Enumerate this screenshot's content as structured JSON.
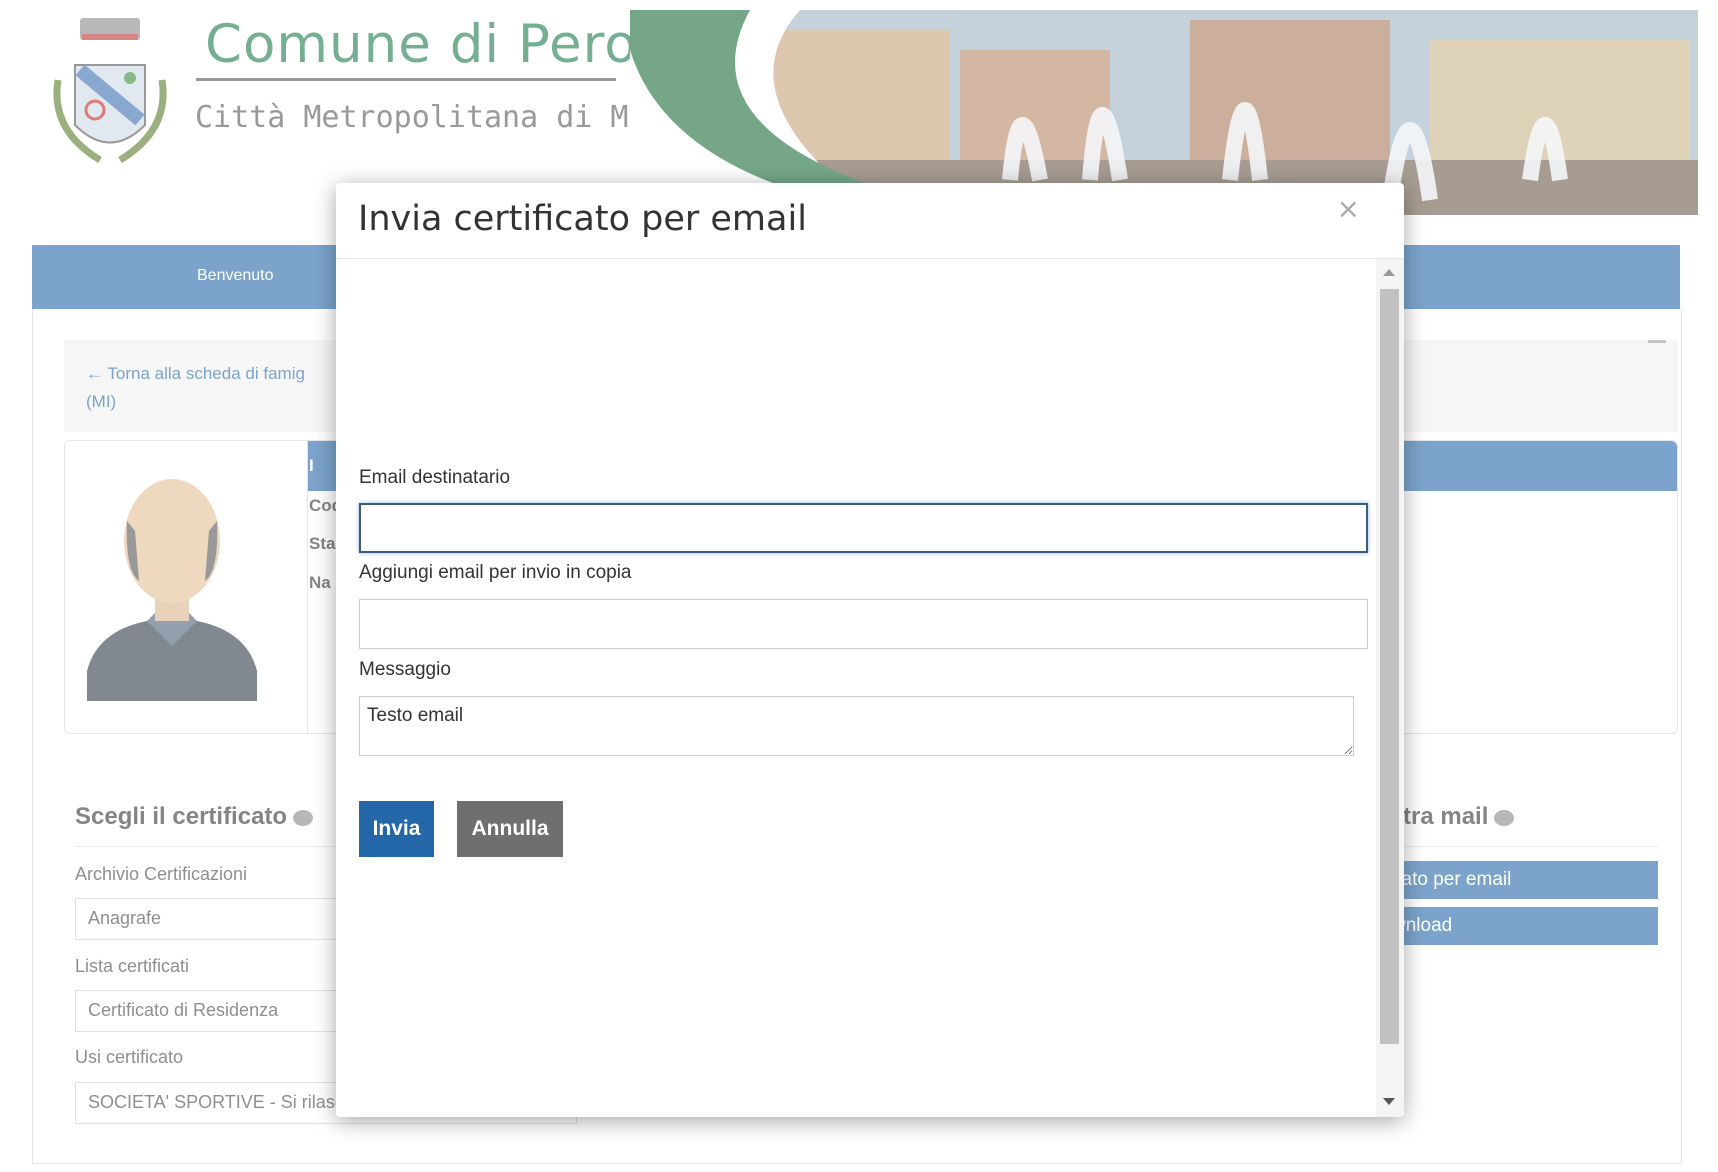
{
  "site": {
    "title": "Comune di Pero",
    "subtitle": "Città Metropolitana di Milano"
  },
  "nav": {
    "items": [
      "Benvenuto"
    ]
  },
  "background": {
    "back_link": "Torna alla scheda di famig",
    "back_link_suffix": "(MI)",
    "info_labels": [
      "Cod",
      "Sta",
      "Na"
    ],
    "section_left_title": "Scegli il certificato",
    "section_right_title": "tra mail",
    "fields": [
      {
        "label": "Archivio Certificazioni",
        "value": "Anagrafe"
      },
      {
        "label": "Lista certificati",
        "value": "Certificato di Residenza"
      },
      {
        "label": "Usi certificato",
        "value": "SOCIETA' SPORTIVE - Si rilasc"
      }
    ],
    "right_buttons": [
      "cato per email",
      "wnload"
    ]
  },
  "modal": {
    "title": "Invia certificato per email",
    "close_symbol": "×",
    "email_label": "Email destinatario",
    "email_value": "",
    "cc_label": "Aggiungi email per invio in copia",
    "cc_value": "",
    "message_label": "Messaggio",
    "message_value": "Testo email",
    "submit_label": "Invia",
    "cancel_label": "Annulla"
  },
  "colors": {
    "primary": "#2367a8",
    "secondary": "#6f6f6f",
    "brand_green": "#1a7a4a"
  }
}
